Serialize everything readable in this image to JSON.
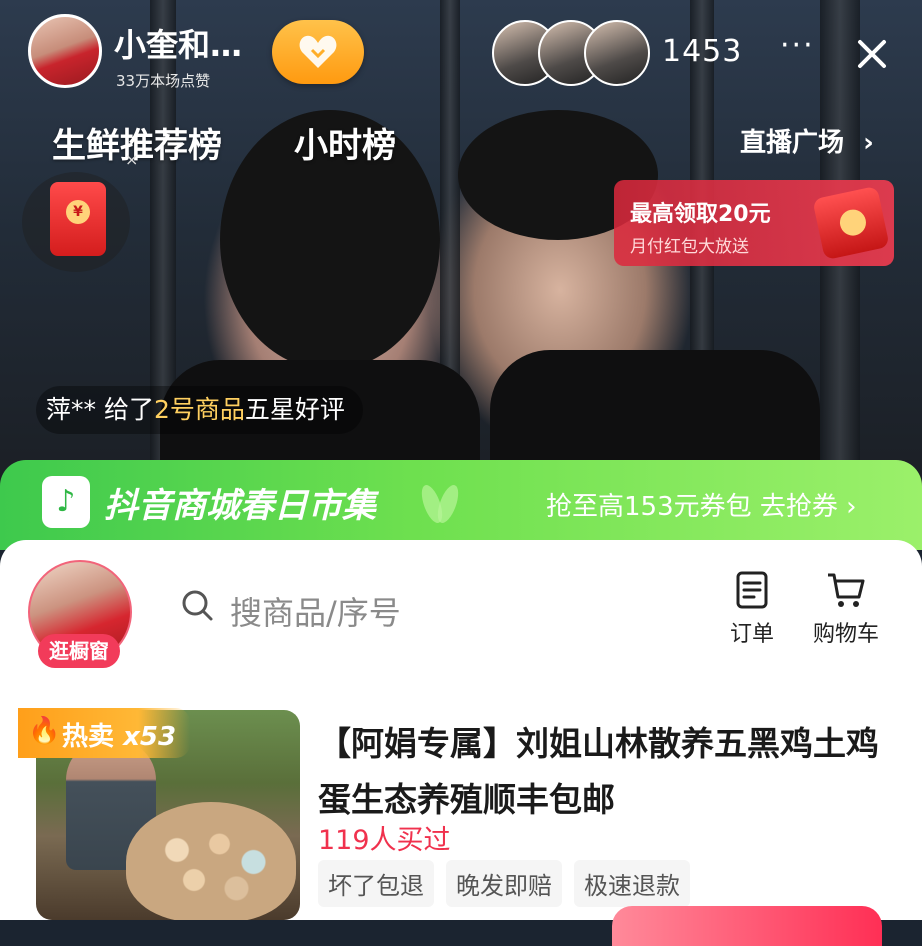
{
  "host": {
    "name": "小奎和…",
    "likes": "33万本场点赞"
  },
  "viewer_count": "1453",
  "ranks": [
    "生鲜推荐榜",
    "小时榜"
  ],
  "plaza": "直播广场",
  "promo": {
    "title": "最高领取20元",
    "subtitle": "月付红包大放送"
  },
  "notice": {
    "user": "萍**",
    "pre": " 给了",
    "highlight": "2号商品",
    "post": "五星好评"
  },
  "banner": {
    "title": "抖音商城春日市集",
    "cta": "抢至高153元券包 去抢券"
  },
  "shop": {
    "tag": "逛橱窗"
  },
  "search": {
    "placeholder": "搜商品/序号"
  },
  "toolbar": {
    "orders_label": "订单",
    "cart_label": "购物车"
  },
  "product": {
    "hot_label": "热卖",
    "hot_count": "x53",
    "title": "【阿娟专属】刘姐山林散养五黑鸡土鸡蛋生态养殖顺丰包邮",
    "sold": "119人买过",
    "tags": [
      "坏了包退",
      "晚发即赔",
      "极速退款"
    ]
  },
  "colors": {
    "accent_red": "#f0314d",
    "banner_green": "#3ec94d",
    "follow_orange": "#ff9a10"
  }
}
